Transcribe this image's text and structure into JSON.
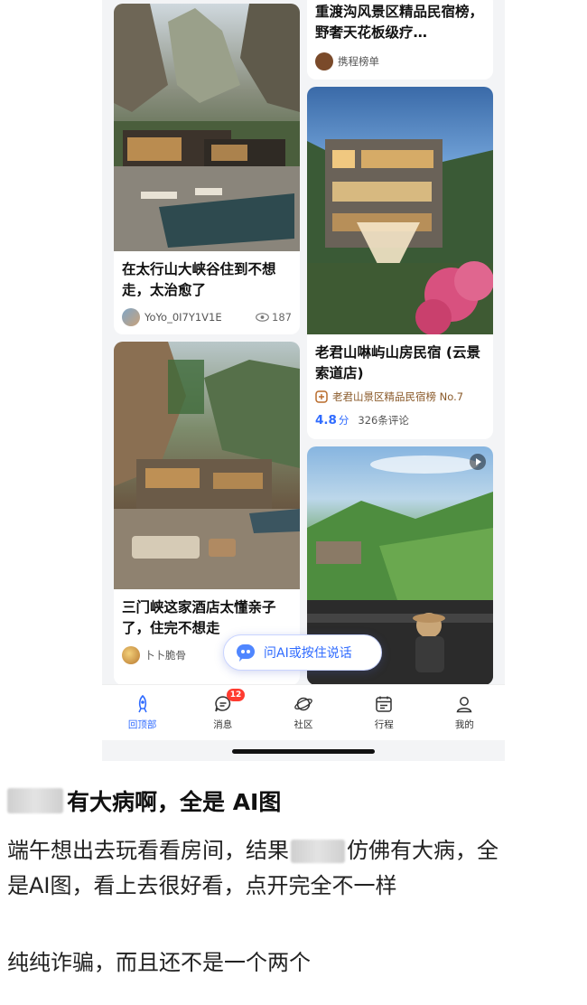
{
  "feed": {
    "card_top_right": {
      "title": "重渡沟风景区精品民宿榜，野奢天花板级疗…",
      "source": "携程榜单"
    },
    "card_canyon": {
      "title": "在太行山大峡谷住到不想走，太治愈了",
      "author": "YoYo_0I7Y1V1E",
      "views": "187"
    },
    "card_modern": {
      "title": "老君山啉屿山房民宿 (云景索道店)",
      "ranking": "老君山景区精品民宿榜 No.7",
      "rating": "4.8",
      "rating_unit": "分",
      "reviews": "326条评论"
    },
    "card_cliff": {
      "title": "三门峡这家酒店太懂亲子了，住完不想走",
      "author": "卜卜脆骨"
    },
    "card_tea": {}
  },
  "ai_pill": {
    "label": "问AI或按住说话"
  },
  "tabbar": {
    "items": [
      {
        "label": "回顶部",
        "icon": "rocket-icon",
        "active": true
      },
      {
        "label": "消息",
        "icon": "message-icon",
        "badge": "12"
      },
      {
        "label": "社区",
        "icon": "planet-icon"
      },
      {
        "label": "行程",
        "icon": "calendar-icon"
      },
      {
        "label": "我的",
        "icon": "user-icon"
      }
    ]
  },
  "post": {
    "title": "有大病啊，全是 AI图",
    "line1a": "端午想出去玩看看房间，结果",
    "line1b": "仿佛有大病，全",
    "line2": "是AI图，看上去很好看，点开完全不一样",
    "line3": "纯纯诈骗，而且还不是一个两个"
  },
  "colors": {
    "accent": "#2f6bff",
    "badge": "#ff3b30",
    "rating": "#2f6bff"
  }
}
